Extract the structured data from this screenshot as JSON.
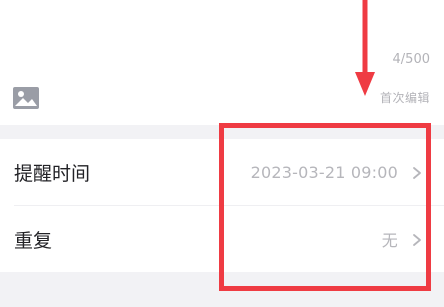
{
  "editor": {
    "char_count": "4/500",
    "image_icon": "image-icon",
    "first_edit": "首次编辑"
  },
  "settings": {
    "remind_label": "提醒时间",
    "remind_value": "2023-03-21 09:00",
    "repeat_label": "重复",
    "repeat_value": "无",
    "chevron_icon": "chevron-right-icon"
  },
  "colors": {
    "annotation": "#ef3b43",
    "secondary_text": "#b6b6bb",
    "primary_text": "#222226",
    "separator": "#f2f2f5"
  }
}
